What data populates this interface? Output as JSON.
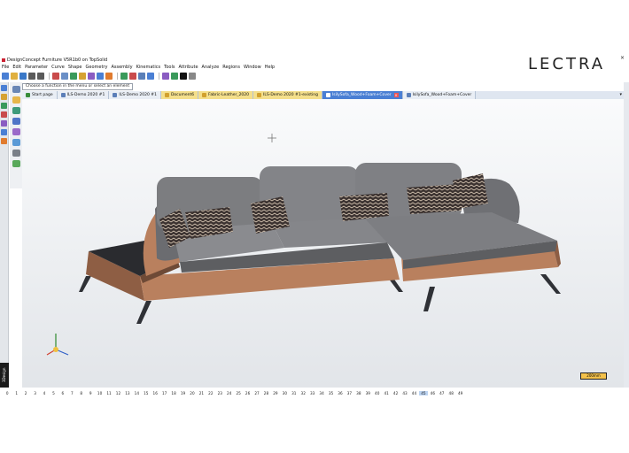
{
  "window": {
    "title": "DesignConcept Furniture V5R1b0 on TopSolid",
    "logo": "LECTRA",
    "close": "×"
  },
  "menu": [
    "File",
    "Edit",
    "Parameter",
    "Curve",
    "Shape",
    "Geometry",
    "Assembly",
    "Kinematics",
    "Tools",
    "Attribute",
    "Analyze",
    "Regions",
    "Window",
    "Help"
  ],
  "hint": "Choose a function in the menu or select an element",
  "tabs": [
    {
      "label": "Start page",
      "style": "plain",
      "icon_color": "#3a8d3a"
    },
    {
      "label": "ILS-Demo 2020 #1",
      "style": "plain",
      "icon_color": "#5c7fb8"
    },
    {
      "label": "ILS-Demo 2020 #1",
      "style": "plain",
      "icon_color": "#5c7fb8"
    },
    {
      "label": "Document6",
      "style": "yellow",
      "icon_color": "#d2a12e"
    },
    {
      "label": "Fabric-Leather_2020",
      "style": "yellow",
      "icon_color": "#d2a12e"
    },
    {
      "label": "ILS-Demo 2020 #1-existing",
      "style": "yellow",
      "icon_color": "#d2a12e"
    },
    {
      "label": "IsilySofa_Wood+Foam+Cover",
      "style": "active",
      "icon_color": "#ffffff"
    },
    {
      "label": "IsilySofa_Wood+Foam+Cover",
      "style": "plain",
      "icon_color": "#5c7fb8"
    }
  ],
  "scale_label": "200mm",
  "vertical_brand": "3Design",
  "status_numbers": [
    "0",
    "1",
    "2",
    "3",
    "4",
    "5",
    "6",
    "7",
    "8",
    "9",
    "10",
    "11",
    "12",
    "13",
    "14",
    "15",
    "16",
    "17",
    "18",
    "19",
    "20",
    "21",
    "22",
    "23",
    "24",
    "25",
    "26",
    "27",
    "28",
    "29",
    "30",
    "31",
    "32",
    "33",
    "34",
    "35",
    "36",
    "37",
    "38",
    "39",
    "40",
    "41",
    "42",
    "43",
    "44",
    "45",
    "46",
    "47",
    "48",
    "49"
  ],
  "status_highlight": "45",
  "colors": {
    "fabric": "#7c7d80",
    "fabric_dark": "#5d5e61",
    "leather": "#b9805e",
    "leather_dark": "#8e5e44",
    "table_top": "#2a2b2f",
    "legs": "#2f3136",
    "active_tab": "#4a7fd4",
    "accent_yellow": "#f4df8b"
  },
  "toolbar_icons": [
    "new-icon",
    "open-icon",
    "save-icon",
    "undo-icon",
    "redo-icon",
    "cut-icon",
    "curve-icon",
    "shape-icon",
    "geometry-icon",
    "assembly-icon",
    "tools-icon",
    "attribute-icon",
    "analyze-icon",
    "render-icon",
    "zoom-icon",
    "view-icon",
    "layers-icon",
    "material-icon",
    "color-icon",
    "line-style-icon"
  ]
}
